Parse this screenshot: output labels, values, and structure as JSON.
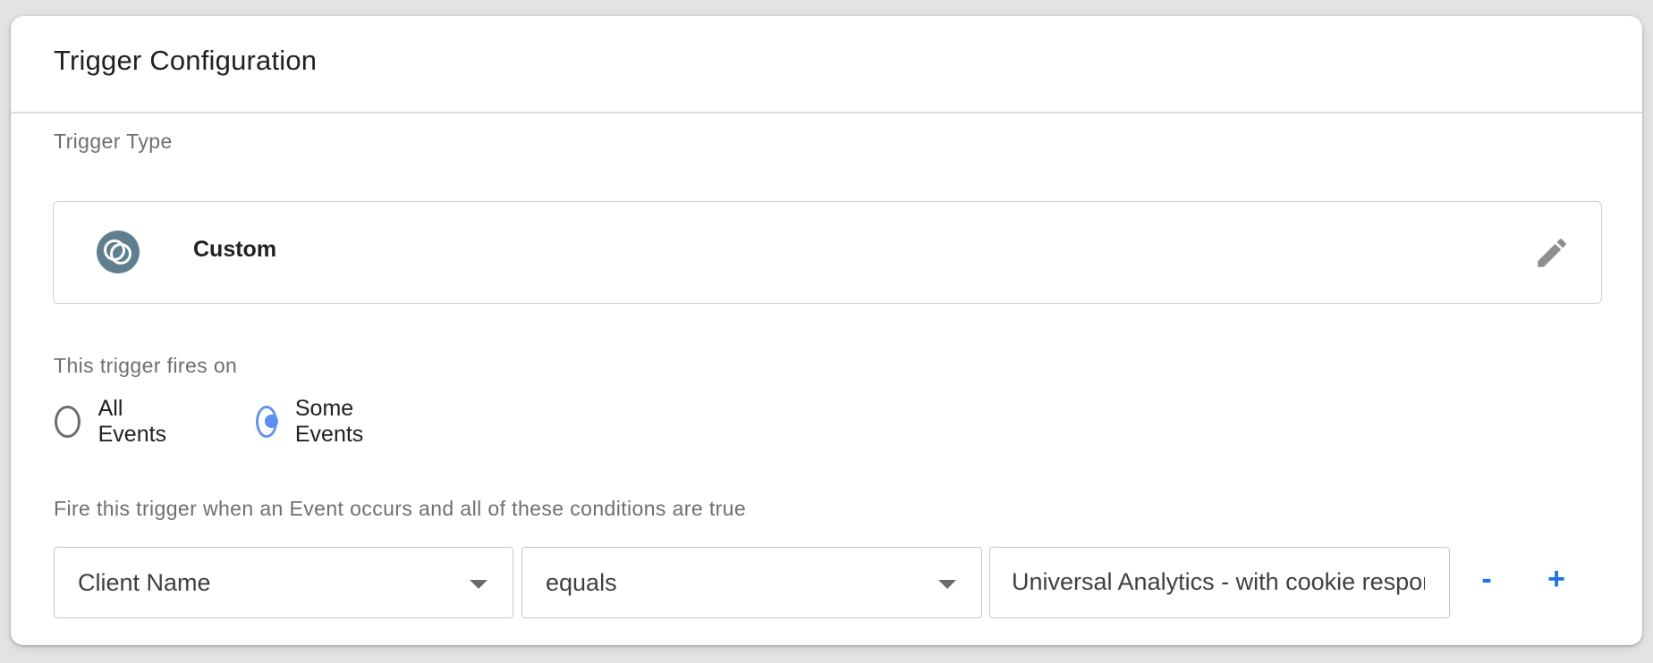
{
  "card": {
    "title": "Trigger Configuration"
  },
  "trigger_type": {
    "label": "Trigger Type",
    "name": "Custom",
    "icon": "custom-trigger-icon",
    "icon_color": "#5f7f8f",
    "edit_icon": "pencil-icon"
  },
  "fires_on": {
    "label": "This trigger fires on",
    "options": [
      {
        "label": "All Events",
        "selected": false
      },
      {
        "label": "Some Events",
        "selected": true
      }
    ]
  },
  "conditions": {
    "label": "Fire this trigger when an Event occurs and all of these conditions are true",
    "variable": "Client Name",
    "operator": "equals",
    "value": "Universal Analytics - with cookie response",
    "remove_label": "-",
    "add_label": "+"
  },
  "colors": {
    "accent": "#1a73e8",
    "radio_selected": "#5c8df0"
  }
}
